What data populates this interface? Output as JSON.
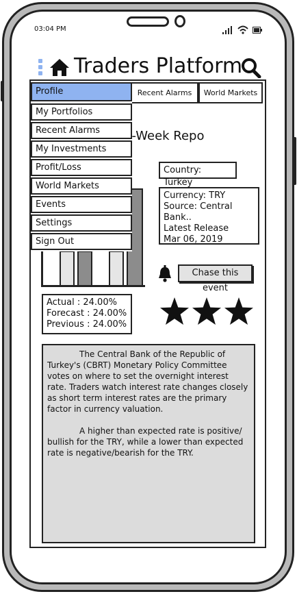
{
  "status_bar": {
    "time": "03:04 PM"
  },
  "header": {
    "title": "Traders Platform"
  },
  "tabs": [
    "Recent Alarms",
    "World Markets"
  ],
  "menu": {
    "items": [
      "Profile",
      "My Portfolios",
      "Recent Alarms",
      "My Investments",
      "Profit/Loss",
      "World Markets",
      "Events",
      "Settings",
      "Sign Out"
    ],
    "selected": "Profile"
  },
  "event": {
    "title_visible": "ne-Week Repo",
    "country": "Country: Turkey",
    "details": [
      "Currency: TRY",
      "Source:  Central Bank..",
      "Latest Release",
      "Mar 06, 2019"
    ],
    "chase_button": "Chase this event",
    "stats": [
      "Actual : 24.00%",
      "Forecast : 24.00%",
      "Previous : 24.00%"
    ],
    "importance_stars": 3,
    "description": [
      "The Central Bank of the Republic of Turkey's (CBRT) Monetary Policy Committee votes on where to set the overnight interest rate. Traders watch interest rate changes closely as short term interest rates are the primary factor in currency valuation.",
      "A higher than expected rate is positive/ bullish for the TRY, while a lower than expected rate is negative/bearish for the TRY."
    ]
  },
  "colors": {
    "menu_selected": "#8fb3f0",
    "bar_dark": "#8c8c8c",
    "bar_light": "#e6e6e6",
    "phone_frame": "#b9b9b9",
    "panel_gray": "#dcdcdc"
  },
  "icons": [
    "hamburger-icon",
    "home-icon",
    "search-icon",
    "bell-icon",
    "star-icon",
    "signal-icon",
    "wifi-icon",
    "battery-icon"
  ]
}
